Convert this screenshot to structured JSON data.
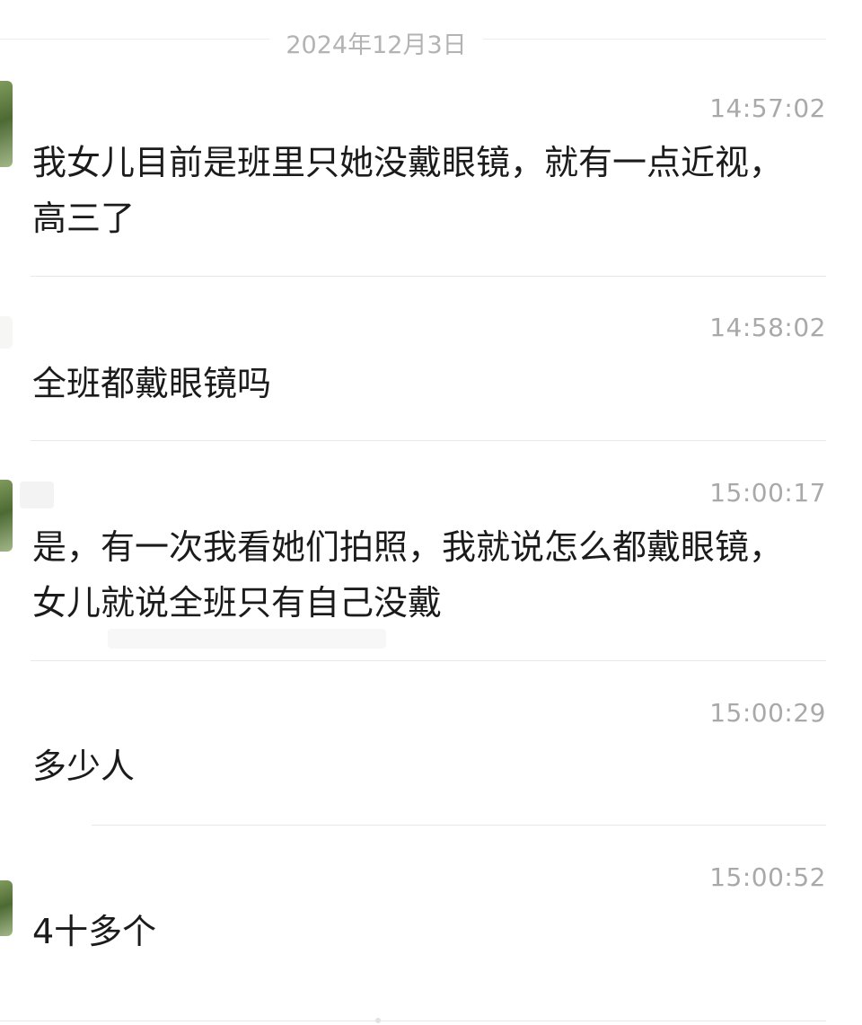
{
  "date_separator": "2024年12月3日",
  "messages": [
    {
      "time": "14:57:02",
      "text": "我女儿目前是班里只她没戴眼镜，就有一点近视，高三了"
    },
    {
      "time": "14:58:02",
      "text": "全班都戴眼镜吗"
    },
    {
      "time": "15:00:17",
      "text": "是，有一次我看她们拍照，我就说怎么都戴眼镜，女儿就说全班只有自己没戴"
    },
    {
      "time": "15:00:29",
      "text": "多少人"
    },
    {
      "time": "15:00:52",
      "text": "4十多个"
    }
  ]
}
